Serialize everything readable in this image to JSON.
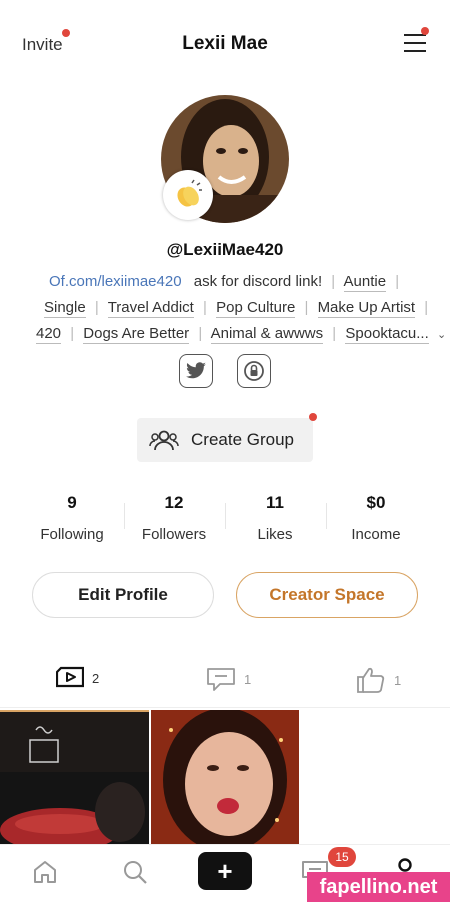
{
  "header": {
    "invite_label": "Invite",
    "title": "Lexii Mae"
  },
  "profile": {
    "handle": "@LexiiMae420",
    "link": "Of.com/lexiimae420",
    "bio": "ask for discord link!",
    "tags": [
      "Auntie",
      "Single",
      "Travel Addict",
      "Pop Culture",
      "Make Up Artist",
      "420",
      "Dogs Are Better",
      "Animal & awwws",
      "Spooktacu..."
    ]
  },
  "social": {
    "icons": [
      "twitter-icon",
      "lock-icon"
    ]
  },
  "create_group": {
    "label": "Create Group"
  },
  "stats": [
    {
      "value": "9",
      "label": "Following"
    },
    {
      "value": "12",
      "label": "Followers"
    },
    {
      "value": "11",
      "label": "Likes"
    },
    {
      "value": "$0",
      "label": "Income"
    }
  ],
  "buttons": {
    "edit_profile": "Edit Profile",
    "creator_space": "Creator Space"
  },
  "content_tabs": [
    {
      "icon": "video-icon",
      "count": "2"
    },
    {
      "icon": "comment-icon",
      "count": "1"
    },
    {
      "icon": "thumbs-up-icon",
      "count": "1"
    }
  ],
  "navbar": {
    "plus_label": "+",
    "messages_badge": "15"
  },
  "watermark": "fapellino.net",
  "colors": {
    "accent": "#c4762a",
    "notification": "#e0463c",
    "link": "#4a76b8",
    "watermark": "#e8438a"
  }
}
